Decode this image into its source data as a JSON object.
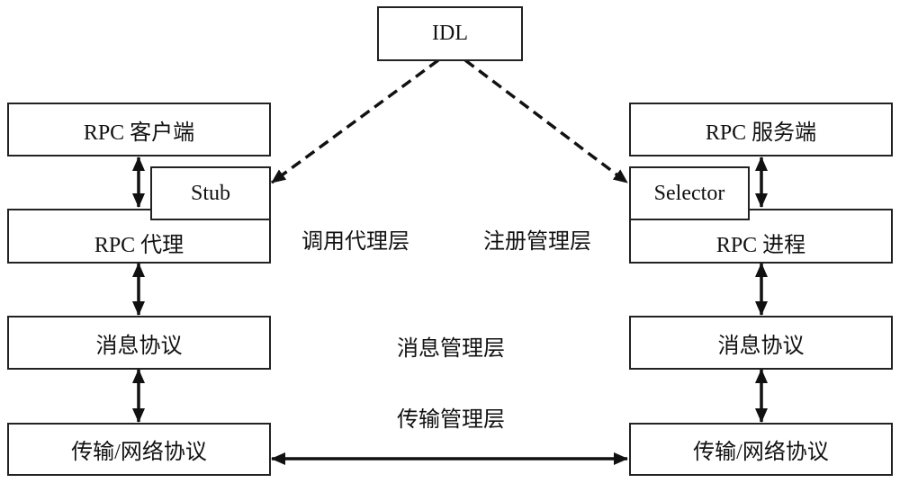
{
  "diagram": {
    "nodes": {
      "idl": "IDL",
      "client": "RPC 客户端",
      "stub": "Stub",
      "client_proxy": "RPC 代理",
      "client_msg": "消息协议",
      "client_transport": "传输/网络协议",
      "server": "RPC 服务端",
      "selector": "Selector",
      "server_process": "RPC 进程",
      "server_msg": "消息协议",
      "server_transport": "传输/网络协议"
    },
    "layers": {
      "call_proxy": "调用代理层",
      "registry": "注册管理层",
      "message": "消息管理层",
      "transport": "传输管理层"
    },
    "edges": [
      {
        "from": "idl",
        "to": "stub",
        "style": "dashed",
        "direction": "forward"
      },
      {
        "from": "idl",
        "to": "selector",
        "style": "dashed",
        "direction": "forward"
      },
      {
        "from": "client",
        "to": "client_proxy",
        "style": "solid",
        "direction": "both"
      },
      {
        "from": "client_proxy",
        "to": "client_msg",
        "style": "solid",
        "direction": "both"
      },
      {
        "from": "client_msg",
        "to": "client_transport",
        "style": "solid",
        "direction": "both"
      },
      {
        "from": "server",
        "to": "server_process",
        "style": "solid",
        "direction": "both"
      },
      {
        "from": "server_process",
        "to": "server_msg",
        "style": "solid",
        "direction": "both"
      },
      {
        "from": "server_msg",
        "to": "server_transport",
        "style": "solid",
        "direction": "both"
      },
      {
        "from": "client_transport",
        "to": "server_transport",
        "style": "solid",
        "direction": "both"
      }
    ]
  }
}
